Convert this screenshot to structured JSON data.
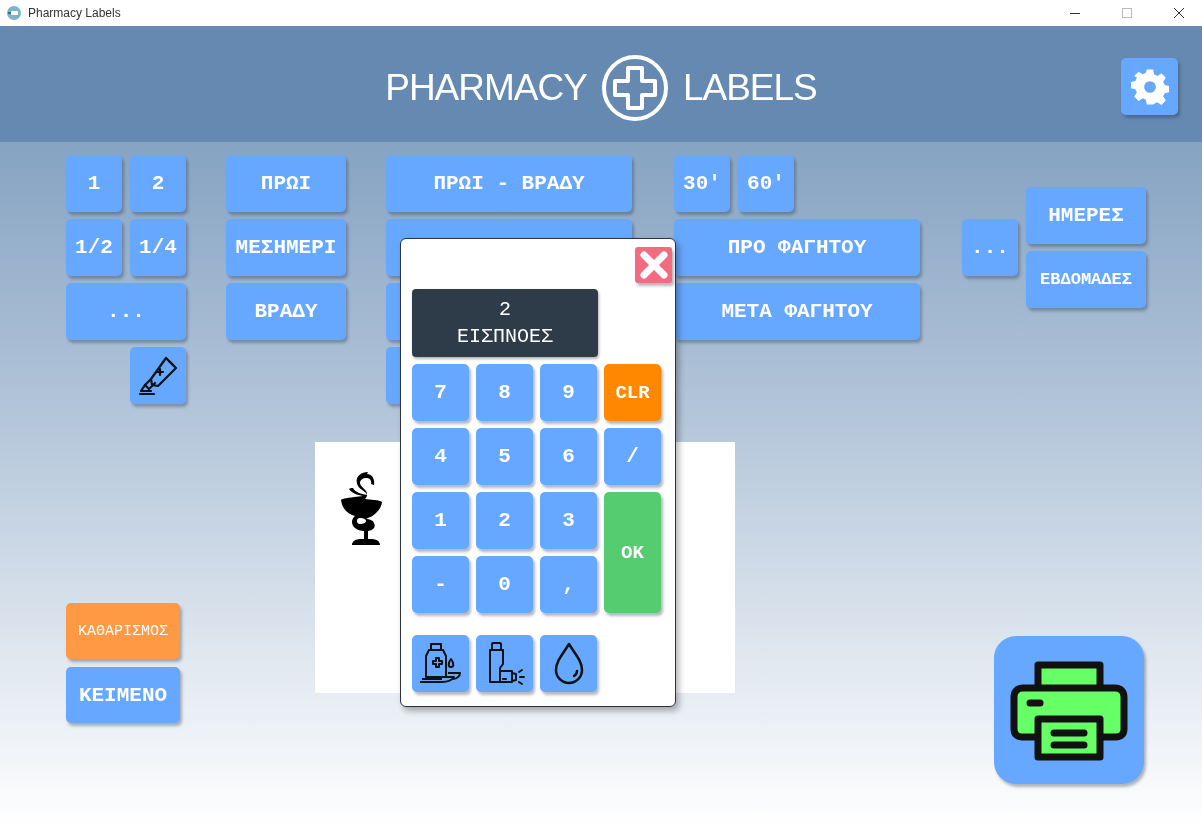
{
  "window": {
    "title": "Pharmacy Labels"
  },
  "header": {
    "title_left": "PHARMACY",
    "title_right": "LABELS"
  },
  "quantity": {
    "buttons": [
      "1",
      "2",
      "1/2",
      "1/4",
      "..."
    ],
    "icon_button": {
      "kind": "ointment"
    }
  },
  "times": [
    "ΠΡΩΙ",
    "ΜΕΣΗΜΕΡΙ",
    "ΒΡΑΔΥ"
  ],
  "combos": [
    {
      "kind": "text",
      "label": "ΠΡΩΙ - ΒΡΑΔΥ"
    },
    {
      "kind": "covered"
    },
    {
      "kind": "covered"
    },
    {
      "kind": "covered"
    }
  ],
  "meal": [
    "30'",
    "60'",
    "ΠΡΟ ΦΑΓΗΤΟΥ",
    "ΜΕΤΑ ΦΑΓΗΤΟΥ"
  ],
  "duration": {
    "more": "...",
    "units": [
      "ΗΜΕΡΕΣ",
      "ΕΒΔΟΜΑΔΕΣ"
    ]
  },
  "actions": [
    {
      "label": "ΚΑΘΑΡΙΣΜΟΣ",
      "kind": "clear"
    },
    {
      "label": "ΚΕΙΜΕΝΟ",
      "kind": "normal"
    }
  ],
  "keypad": {
    "display": [
      "2",
      "ΕΙΣΠΝΟΕΣ"
    ],
    "keys": [
      {
        "label": "7",
        "kind": "digit"
      },
      {
        "label": "8",
        "kind": "digit"
      },
      {
        "label": "9",
        "kind": "digit"
      },
      {
        "label": "CLR",
        "kind": "clear"
      },
      {
        "label": "4",
        "kind": "digit"
      },
      {
        "label": "5",
        "kind": "digit"
      },
      {
        "label": "6",
        "kind": "digit"
      },
      {
        "label": "/",
        "kind": "digit"
      },
      {
        "label": "1",
        "kind": "digit"
      },
      {
        "label": "2",
        "kind": "digit"
      },
      {
        "label": "3",
        "kind": "digit"
      },
      {
        "label": "OK",
        "kind": "ok"
      },
      {
        "label": "-",
        "kind": "digit"
      },
      {
        "label": "0",
        "kind": "digit"
      },
      {
        "label": ",",
        "kind": "digit"
      }
    ],
    "form_buttons": [
      {
        "kind": "syrup"
      },
      {
        "kind": "inhaler"
      },
      {
        "kind": "drops"
      }
    ]
  }
}
